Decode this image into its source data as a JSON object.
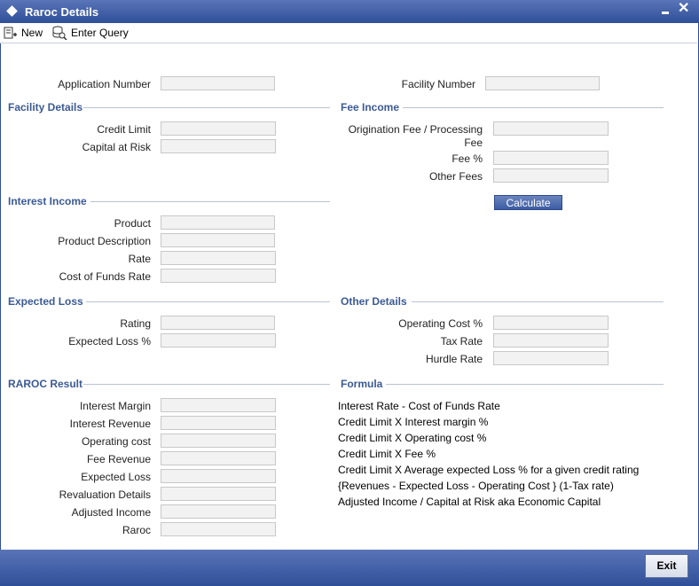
{
  "window": {
    "title": "Raroc Details"
  },
  "toolbar": {
    "new_label": "New",
    "enter_query_label": "Enter Query"
  },
  "top": {
    "application_number": "Application Number",
    "facility_number": "Facility Number"
  },
  "facility_details": {
    "heading": "Facility Details",
    "credit_limit": "Credit Limit",
    "capital_at_risk": "Capital at Risk"
  },
  "fee_income": {
    "heading": "Fee Income",
    "origination_fee_line1": "Origination Fee / Processing",
    "origination_fee_line2": "Fee",
    "fee_pct": "Fee %",
    "other_fees": "Other Fees",
    "calculate": "Calculate"
  },
  "interest_income": {
    "heading": "Interest Income",
    "product": "Product",
    "product_description": "Product Description",
    "rate": "Rate",
    "cost_of_funds_rate": "Cost of Funds Rate"
  },
  "expected_loss": {
    "heading": "Expected Loss",
    "rating": "Rating",
    "expected_loss_pct": "Expected Loss %"
  },
  "other_details": {
    "heading": "Other Details",
    "operating_cost_pct": "Operating Cost %",
    "tax_rate": "Tax Rate",
    "hurdle_rate": "Hurdle Rate"
  },
  "raroc_result": {
    "heading": "RAROC Result",
    "interest_margin": "Interest Margin",
    "interest_revenue": "Interest Revenue",
    "operating_cost": "Operating cost",
    "fee_revenue": "Fee Revenue",
    "expected_loss": "Expected Loss",
    "revaluation_details": "Revaluation Details",
    "adjusted_income": "Adjusted Income",
    "raroc": "Raroc"
  },
  "formula": {
    "heading": "Formula",
    "lines": [
      "Interest Rate - Cost of Funds Rate",
      "Credit Limit X Interest margin %",
      "Credit Limit X Operating cost %",
      "Credit Limit X Fee %",
      "Credit Limit X Average expected Loss % for a given credit rating",
      "{Revenues - Expected Loss - Operating Cost } (1-Tax rate)",
      "Adjusted Income / Capital at Risk aka Economic Capital"
    ]
  },
  "footer": {
    "exit_label": "Exit"
  },
  "colors": {
    "title_bar": "#3b5aa3",
    "section_heading": "#3b5a94",
    "field_bg": "#f2f2f2"
  }
}
